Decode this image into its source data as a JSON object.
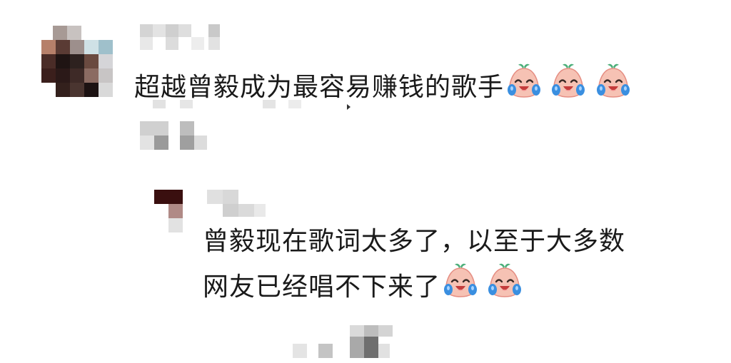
{
  "comment": {
    "text": "超越曾毅成为最容易赚钱的歌手",
    "emoji": [
      "crying-laughing",
      "crying-laughing",
      "crying-laughing"
    ]
  },
  "reply": {
    "line1": "曾毅现在歌词太多了，以至于大多数",
    "line2": "网友已经唱不下来了",
    "emoji": [
      "crying-laughing",
      "crying-laughing"
    ]
  },
  "colors": {
    "text": "#1a1a1a",
    "emoji_face": "#f7c7b8",
    "emoji_tear": "#3a8fe0",
    "emoji_leaf": "#4caf7a"
  }
}
